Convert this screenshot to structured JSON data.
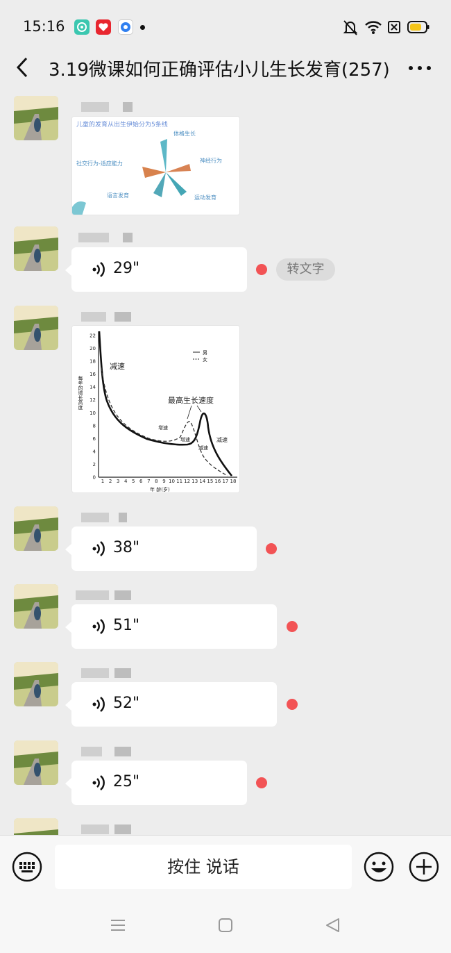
{
  "status_bar": {
    "time": "15:16",
    "battery_color": "#f5c518"
  },
  "header": {
    "title": "3.19微课如何正确评估小儿生长发育(257)",
    "back_icon": "chevron-left-icon",
    "more_icon": "more-dots-icon"
  },
  "messages": [
    {
      "type": "image",
      "image": {
        "caption": "儿童的发育从出生伊始分为5条线",
        "labels": [
          "体格生长",
          "神经行为",
          "运动发育",
          "语言发育",
          "社交行为-适应能力"
        ]
      }
    },
    {
      "type": "voice",
      "duration": "29\"",
      "unread": true,
      "transcribe_label": "转文字"
    },
    {
      "type": "image",
      "chart": {
        "ylabel": "每年的增长高度",
        "xlabel": "年 龄(岁)",
        "legend": [
          "男",
          "女"
        ],
        "annotations": [
          "减速",
          "最高生长速度",
          "增速",
          "增速",
          "减速",
          "减速"
        ],
        "y_ticks": [
          "0",
          "2",
          "4",
          "6",
          "8",
          "10",
          "12",
          "14",
          "16",
          "18",
          "20",
          "22"
        ],
        "x_ticks": [
          "1",
          "2",
          "3",
          "4",
          "5",
          "6",
          "7",
          "8",
          "9",
          "10",
          "11",
          "12",
          "13",
          "14",
          "15",
          "16",
          "17",
          "18"
        ]
      }
    },
    {
      "type": "voice",
      "duration": "38\"",
      "unread": true
    },
    {
      "type": "voice",
      "duration": "51\"",
      "unread": true
    },
    {
      "type": "voice",
      "duration": "52\"",
      "unread": true
    },
    {
      "type": "voice",
      "duration": "25\"",
      "unread": true
    }
  ],
  "input_bar": {
    "hold_to_talk_label": "按住 说话"
  },
  "nav": {
    "menu_icon": "menu-icon",
    "home_icon": "home-icon",
    "back_icon": "back-triangle-icon"
  }
}
